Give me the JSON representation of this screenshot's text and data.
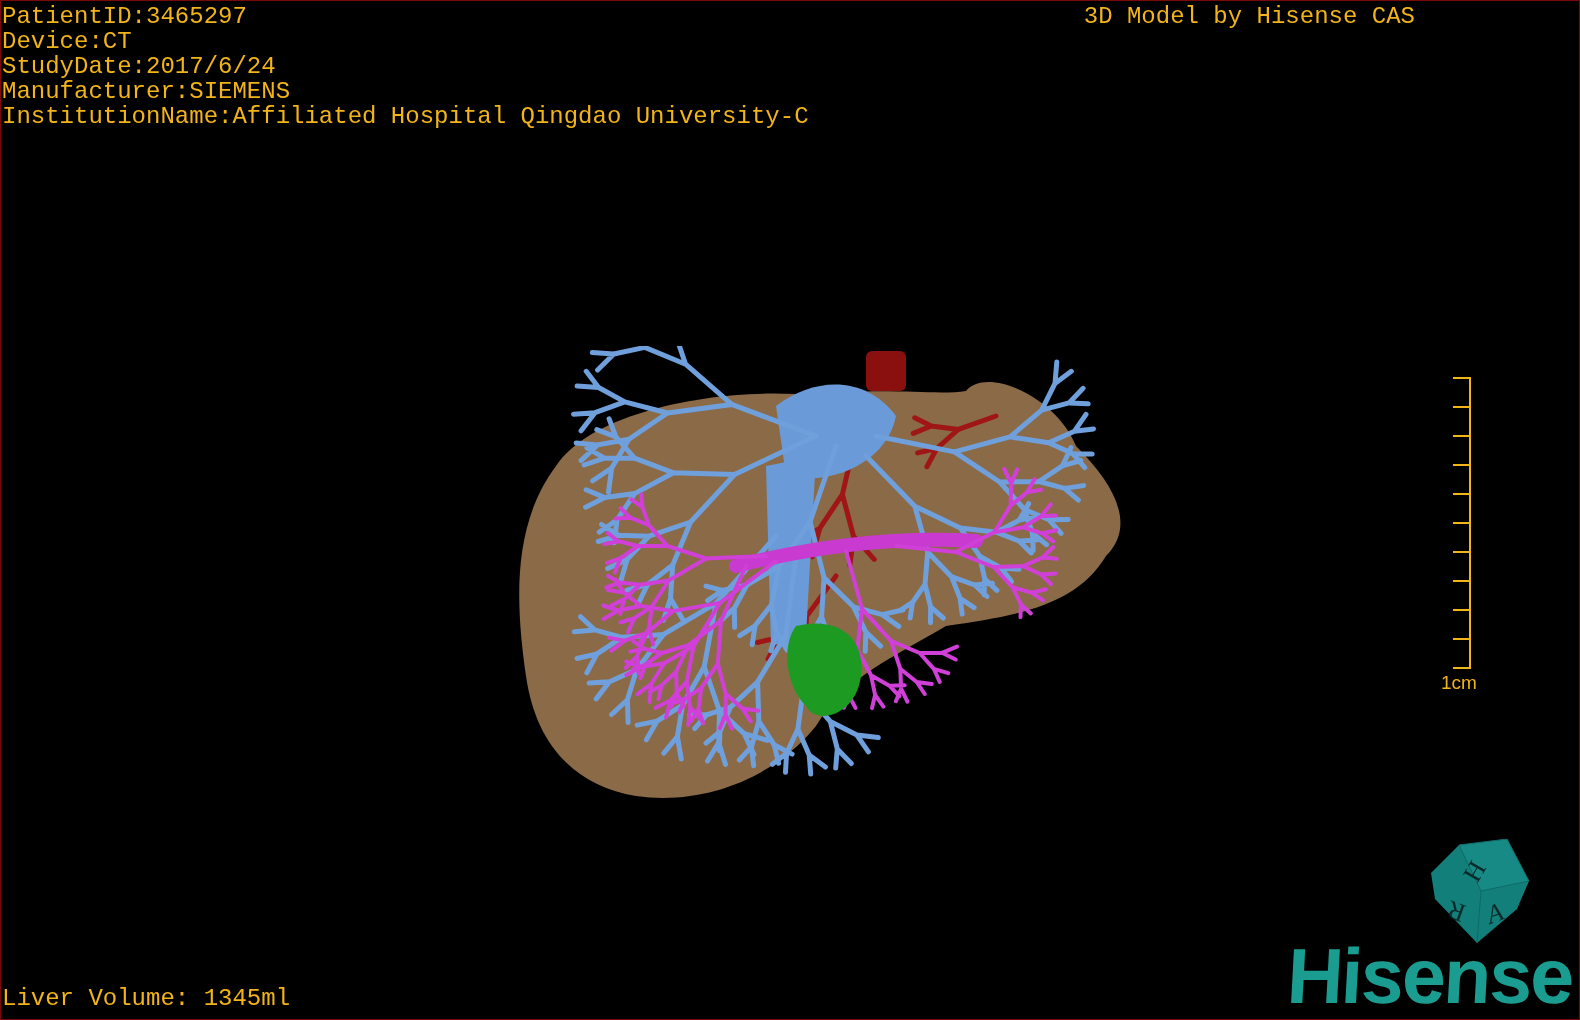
{
  "study_info": [
    "PatientID:3465297",
    "Device:CT",
    "StudyDate:2017/6/24",
    "Manufacturer:SIEMENS",
    "InstitutionName:Affiliated Hospital Qingdao University-C"
  ],
  "model_title": "3D Model by Hisense CAS",
  "scale_bar": {
    "label": "1cm"
  },
  "orientation_cube": {
    "top": "H",
    "left": "R",
    "right": "A"
  },
  "liver_volume": "Liver Volume: 1345ml",
  "logo": "Hisense"
}
